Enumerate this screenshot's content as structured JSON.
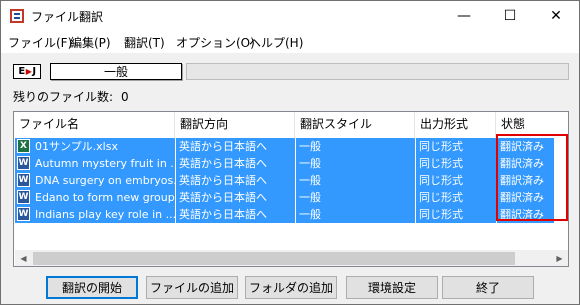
{
  "window": {
    "title": "ファイル翻訳",
    "minimize_glyph": "—",
    "maximize_glyph": "☐",
    "close_glyph": "✕"
  },
  "menu": [
    "ファイル(F)",
    "編集(P)",
    "翻訳(T)",
    "オプション(O)",
    "ヘルプ(H)"
  ],
  "toolbar": {
    "logo_left": "E",
    "logo_right": "J",
    "translation_style": "一般"
  },
  "status": {
    "remaining_label": "残りのファイル数:",
    "remaining_count": "0"
  },
  "file_list": {
    "columns": [
      "ファイル名",
      "翻訳方向",
      "翻訳スタイル",
      "出力形式",
      "状態"
    ],
    "rows": [
      {
        "icon": "excel-file-icon",
        "name": "01サンプル.xlsx",
        "direction": "英語から日本語へ",
        "style": "一般",
        "format": "同じ形式",
        "status": "翻訳済み"
      },
      {
        "icon": "word-file-icon",
        "name": "Autumn mystery fruit in ...",
        "direction": "英語から日本語へ",
        "style": "一般",
        "format": "同じ形式",
        "status": "翻訳済み"
      },
      {
        "icon": "word-file-icon",
        "name": "DNA surgery on embryos...",
        "direction": "英語から日本語へ",
        "style": "一般",
        "format": "同じ形式",
        "status": "翻訳済み"
      },
      {
        "icon": "word-file-icon",
        "name": "Edano to form new group...",
        "direction": "英語から日本語へ",
        "style": "一般",
        "format": "同じ形式",
        "status": "翻訳済み"
      },
      {
        "icon": "word-file-icon",
        "name": "Indians play key role in ...",
        "direction": "英語から日本語へ",
        "style": "一般",
        "format": "同じ形式",
        "status": "翻訳済み"
      }
    ]
  },
  "buttons": {
    "start": "翻訳の開始",
    "add_file": "ファイルの追加",
    "add_folder": "フォルダの追加",
    "settings": "環境設定",
    "exit": "終了"
  },
  "colors": {
    "selection": "#3399ff",
    "highlight_box": "#e00000",
    "default_button_border": "#0078d7"
  }
}
